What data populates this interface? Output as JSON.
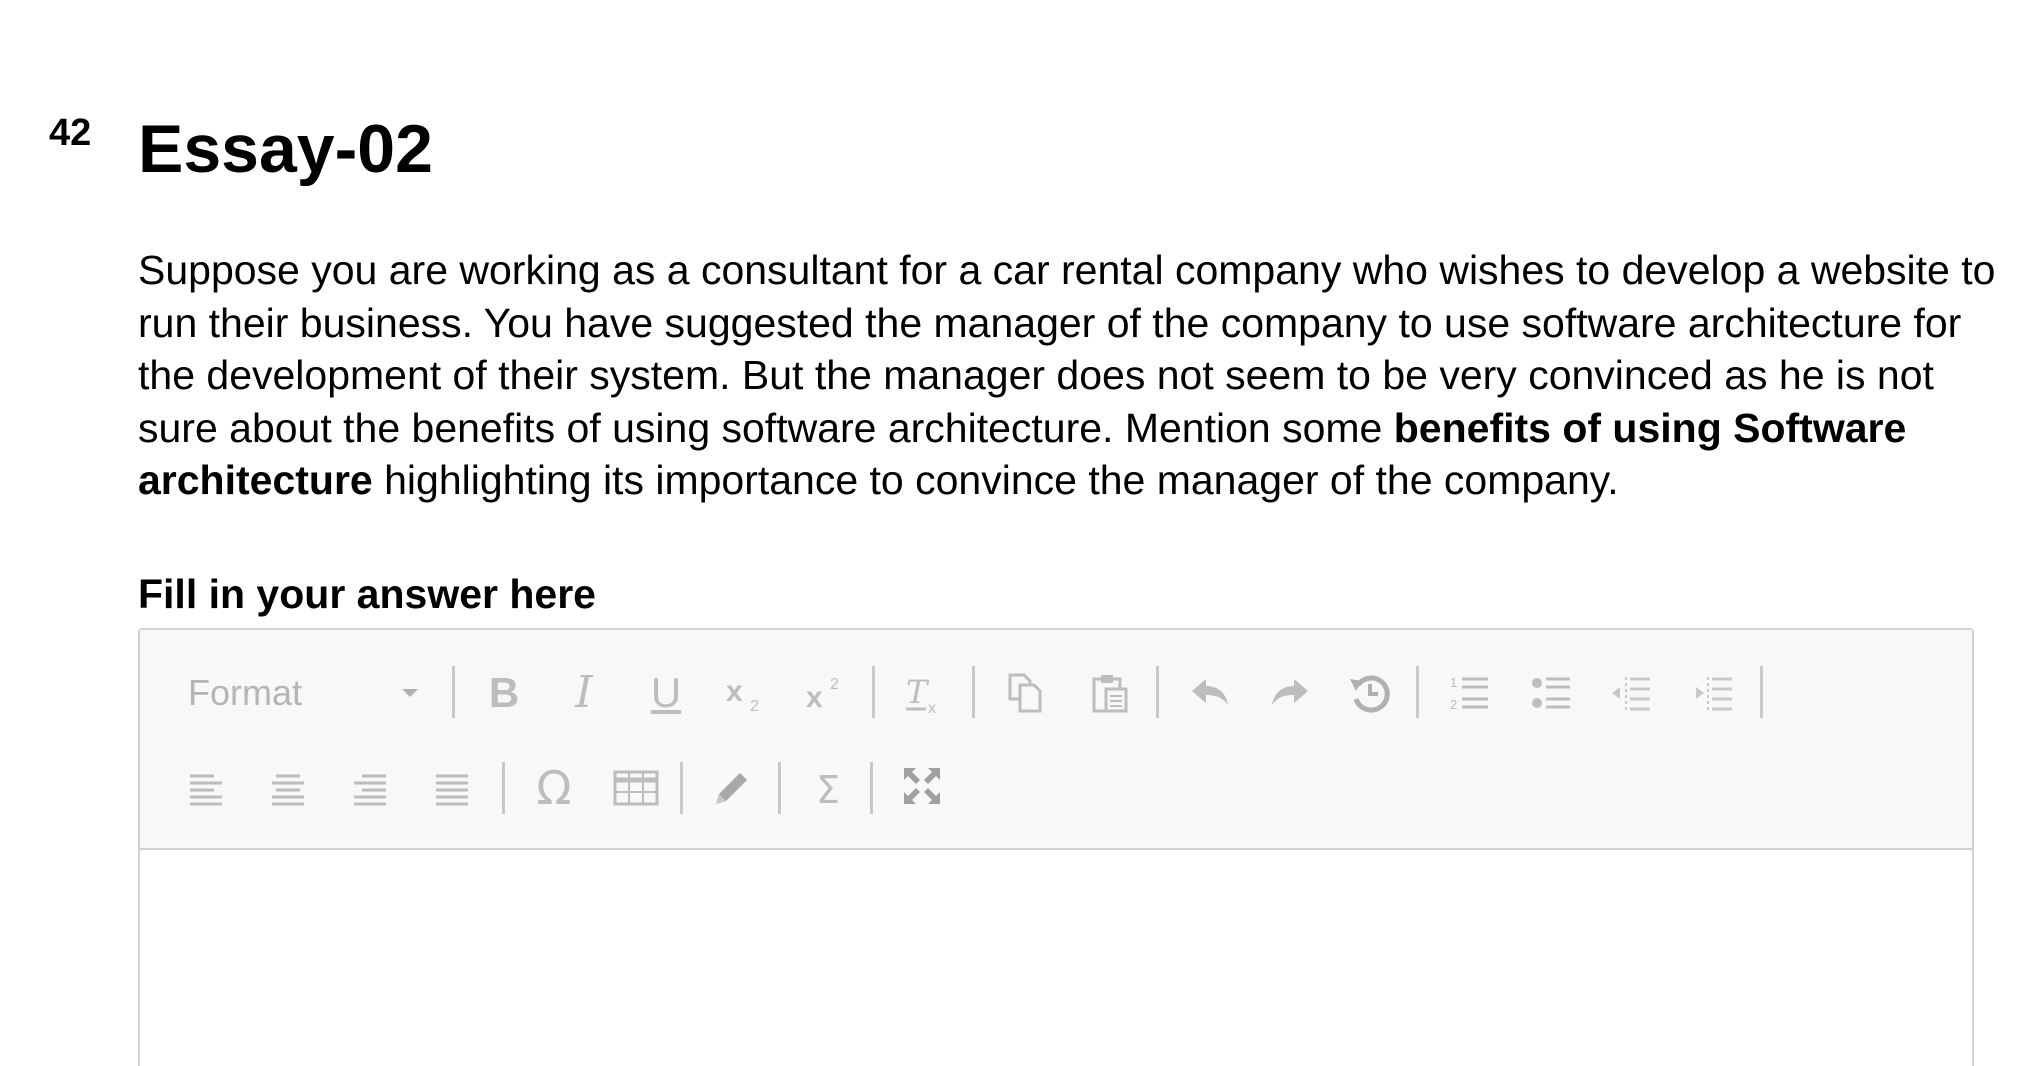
{
  "question": {
    "number": "42",
    "title": "Essay-02",
    "body_part1": "Suppose you are working as a consultant for a car rental company who wishes to develop a website to run their business. You have suggested the manager of the company to use software architecture for the development of their system. But the manager does not seem to be very convinced as he is not sure about the benefits of using software architecture. Mention some ",
    "body_bold": "benefits of using Software architecture",
    "body_part2": " highlighting its importance to convince the manager of the company.",
    "answer_label": "Fill in your answer here"
  },
  "editor": {
    "format_label": "Format",
    "answer_text": "",
    "toolbar_icons": [
      "bold-icon",
      "italic-icon",
      "underline-icon",
      "subscript-icon",
      "superscript-icon",
      "remove-format-icon",
      "copy-icon",
      "paste-icon",
      "undo-icon",
      "redo-icon",
      "history-icon",
      "numbered-list-icon",
      "bulleted-list-icon",
      "decrease-indent-icon",
      "increase-indent-icon",
      "align-left-icon",
      "align-center-icon",
      "align-right-icon",
      "justify-icon",
      "special-character-icon",
      "table-icon",
      "pencil-icon",
      "sigma-icon",
      "fullscreen-icon"
    ],
    "icon_color": "#bdbdbd",
    "toolbar_bg": "#f8f8f8",
    "border_color": "#d1d1d1"
  }
}
